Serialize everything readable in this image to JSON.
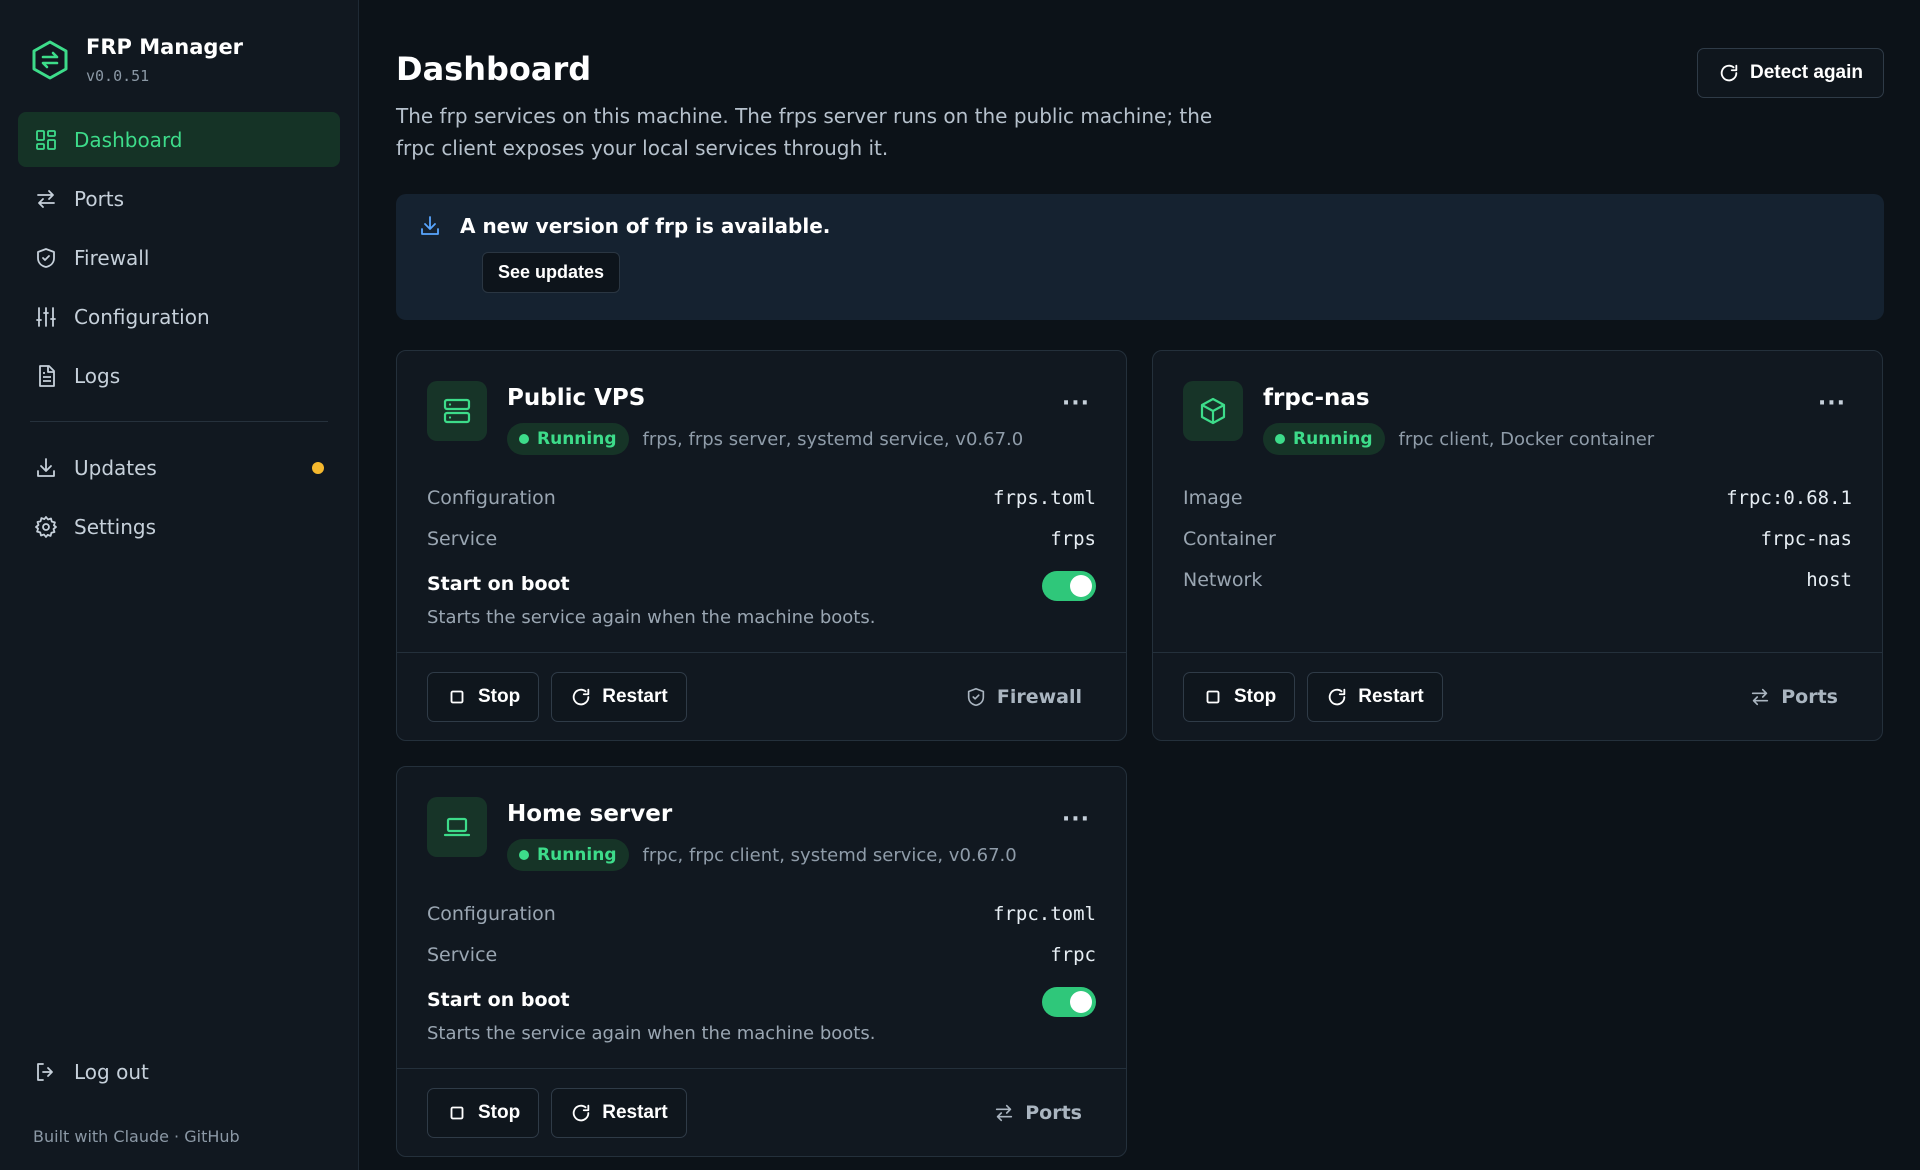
{
  "brand": {
    "name": "FRP Manager",
    "version": "v0.0.51"
  },
  "sidebar": {
    "items": [
      {
        "label": "Dashboard",
        "icon": "grid-icon",
        "active": true
      },
      {
        "label": "Ports",
        "icon": "arrows-icon"
      },
      {
        "label": "Firewall",
        "icon": "shield-icon"
      },
      {
        "label": "Configuration",
        "icon": "sliders-icon"
      },
      {
        "label": "Logs",
        "icon": "file-icon"
      }
    ],
    "secondary": [
      {
        "label": "Updates",
        "icon": "download-icon",
        "has_dot": true
      },
      {
        "label": "Settings",
        "icon": "gear-icon"
      }
    ],
    "logout_label": "Log out",
    "footer": "Built with Claude · GitHub"
  },
  "header": {
    "title": "Dashboard",
    "description": "The frp services on this machine. The frps server runs on the public machine; the frpc client exposes your local services through it.",
    "detect_label": "Detect again"
  },
  "banner": {
    "title": "A new version of frp is available.",
    "button": "See updates"
  },
  "cards": [
    {
      "title": "Public VPS",
      "icon": "server-icon",
      "status": "Running",
      "meta": "frps, frps server, systemd service, v0.67.0",
      "rows": [
        {
          "label": "Configuration",
          "value": "frps.toml"
        },
        {
          "label": "Service",
          "value": "frps"
        }
      ],
      "boot_title": "Start on boot",
      "boot_desc": "Starts the service again when the machine boots.",
      "boot_on": true,
      "stop_label": "Stop",
      "restart_label": "Restart",
      "link_label": "Firewall",
      "link_icon": "shield-icon"
    },
    {
      "title": "frpc-nas",
      "icon": "box-icon",
      "status": "Running",
      "meta": "frpc client, Docker container",
      "rows": [
        {
          "label": "Image",
          "value": "frpc:0.68.1"
        },
        {
          "label": "Container",
          "value": "frpc-nas"
        },
        {
          "label": "Network",
          "value": "host"
        }
      ],
      "stop_label": "Stop",
      "restart_label": "Restart",
      "link_label": "Ports",
      "link_icon": "arrows-icon"
    },
    {
      "title": "Home server",
      "icon": "laptop-icon",
      "status": "Running",
      "meta": "frpc, frpc client, systemd service, v0.67.0",
      "rows": [
        {
          "label": "Configuration",
          "value": "frpc.toml"
        },
        {
          "label": "Service",
          "value": "frpc"
        }
      ],
      "boot_title": "Start on boot",
      "boot_desc": "Starts the service again when the machine boots.",
      "boot_on": true,
      "stop_label": "Stop",
      "restart_label": "Restart",
      "link_label": "Ports",
      "link_icon": "arrows-icon"
    }
  ],
  "colors": {
    "accent": "#3ddc8a",
    "badge_bg": "#163427",
    "dot": "#f5b82e",
    "banner_bg": "#152230"
  }
}
